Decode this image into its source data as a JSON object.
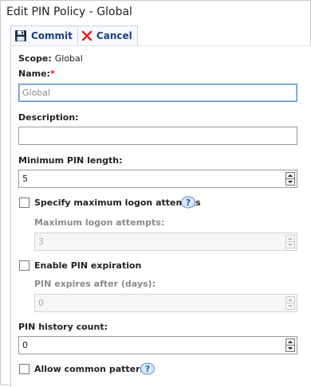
{
  "window": {
    "title": "Edit PIN Policy - Global"
  },
  "toolbar": {
    "commit_label": "Commit",
    "cancel_label": "Cancel"
  },
  "form": {
    "scope_label": "Scope:",
    "scope_value": "Global",
    "name_label": "Name:",
    "name_required_mark": "*",
    "name_value": "Global",
    "description_label": "Description:",
    "description_value": "",
    "min_length_label": "Minimum PIN length:",
    "min_length_value": "5",
    "max_logon_checkbox_label": "Specify maximum logon attempts",
    "max_logon_label": "Maximum logon attempts:",
    "max_logon_value": "3",
    "expiration_checkbox_label": "Enable PIN expiration",
    "expires_after_label": "PIN expires after (days):",
    "expires_after_value": "0",
    "history_label": "PIN history count:",
    "history_value": "0",
    "common_patterns_label": "Allow common patterns"
  },
  "icons": {
    "commit": "floppy-disk-icon",
    "cancel": "red-x-icon",
    "help": "question-mark-help-icon"
  },
  "colors": {
    "toolbar_text": "#1c3f78",
    "cancel_x": "#e02020",
    "required": "#dd1111",
    "focus_border": "#5b8fc9"
  }
}
